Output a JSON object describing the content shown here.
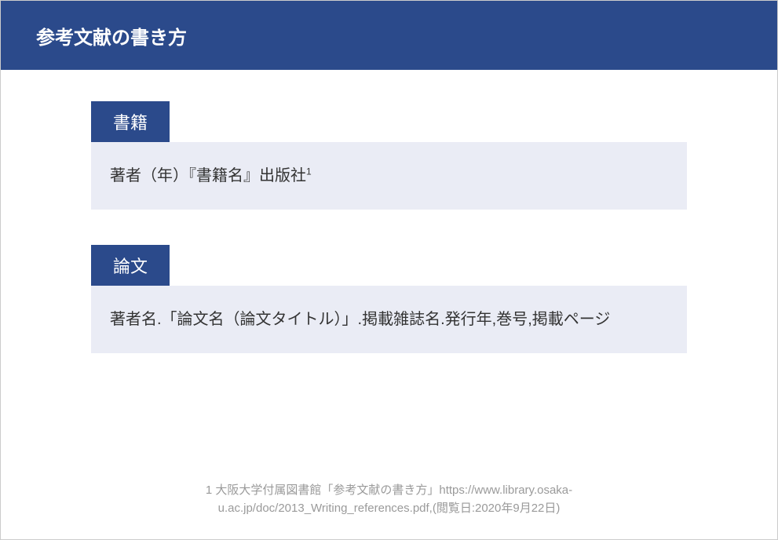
{
  "header": {
    "title": "参考文献の書き方"
  },
  "sections": [
    {
      "label": "書籍",
      "body": "著者（年）『書籍名』出版社",
      "superscript": "1"
    },
    {
      "label": "論文",
      "body": "著者名.「論文名（論文タイトル）」.掲載雑誌名.発行年,巻号,掲載ページ",
      "superscript": ""
    }
  ],
  "footnote": {
    "line1": "1 大阪大学付属図書館「参考文献の書き方」https://www.library.osaka-",
    "line2": "u.ac.jp/doc/2013_Writing_references.pdf,(閲覧日:2020年9月22日)"
  }
}
